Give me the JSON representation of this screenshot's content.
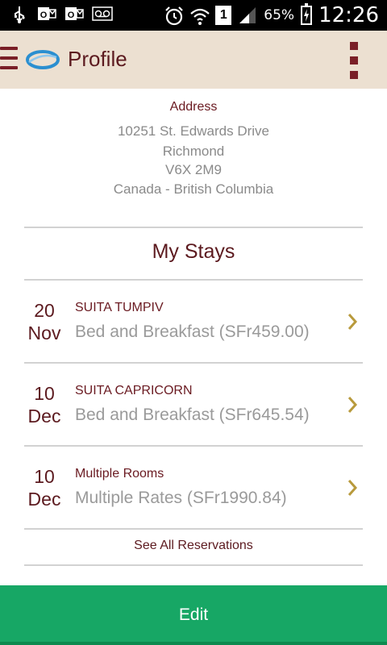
{
  "status_bar": {
    "battery_percent": "65%",
    "time": "12:26",
    "sim_label": "1",
    "icons": [
      "usb-icon",
      "outlook-icon",
      "outlook-icon",
      "voicemail-icon",
      "alarm-icon",
      "wifi-icon",
      "sim-icon",
      "signal-icon",
      "battery-charging-icon"
    ]
  },
  "app_bar": {
    "title": "Profile",
    "menu_icon": "hamburger-menu-icon",
    "logo_icon": "hotel-logo-icon",
    "overflow_icon": "overflow-menu-icon"
  },
  "address": {
    "heading": "Address",
    "lines": [
      "10251 St. Edwards Drive",
      "Richmond",
      "V6X 2M9",
      "Canada - British Columbia"
    ]
  },
  "stays": {
    "title": "My Stays",
    "items": [
      {
        "day": "20",
        "month": "Nov",
        "room": "SUITA TUMPIV",
        "rate": "Bed and Breakfast (SFr459.00)"
      },
      {
        "day": "10",
        "month": "Dec",
        "room": "SUITA CAPRICORN",
        "rate": "Bed and Breakfast (SFr645.54)"
      },
      {
        "day": "10",
        "month": "Dec",
        "room": "Multiple Rooms",
        "rate": "Multiple Rates (SFr1990.84)"
      }
    ],
    "see_all": "See All Reservations"
  },
  "actions": {
    "edit_label": "Edit"
  },
  "colors": {
    "accent_dark_red": "#5c1a1f",
    "app_bar_bg": "#ece0d1",
    "chevron_gold": "#b89a3c",
    "edit_green": "#17a765"
  }
}
